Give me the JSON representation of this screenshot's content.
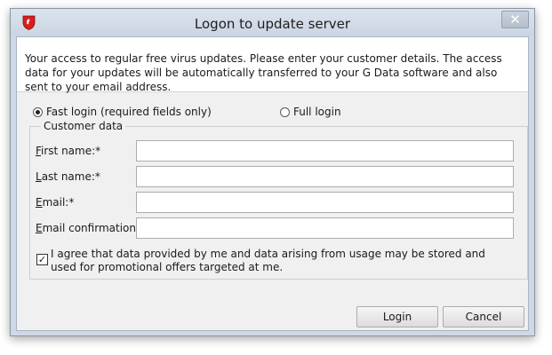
{
  "window": {
    "title": "Logon to update server",
    "close_glyph": "✕",
    "app_icon": "shield-icon"
  },
  "header": {
    "text": "Your access to regular free virus updates. Please enter your customer details. The access data for your updates will be automatically transferred to your G Data software and also sent to your email address."
  },
  "login_mode": {
    "fast_label": "Fast login (required fields only)",
    "full_label": "Full login",
    "selected": "fast"
  },
  "customer_data": {
    "legend": "Customer data",
    "fields": [
      {
        "key": "F",
        "rest": "irst name:*",
        "value": ""
      },
      {
        "key": "L",
        "rest": "ast name:*",
        "value": ""
      },
      {
        "key": "E",
        "rest": "mail:*",
        "value": ""
      },
      {
        "key": "E",
        "rest": "mail confirmation:*",
        "value": ""
      }
    ]
  },
  "consent": {
    "checked": true,
    "text": "I agree that data provided by me and data arising from usage may be stored and used for promotional offers targeted at me."
  },
  "buttons": {
    "login": "Login",
    "cancel": "Cancel"
  }
}
